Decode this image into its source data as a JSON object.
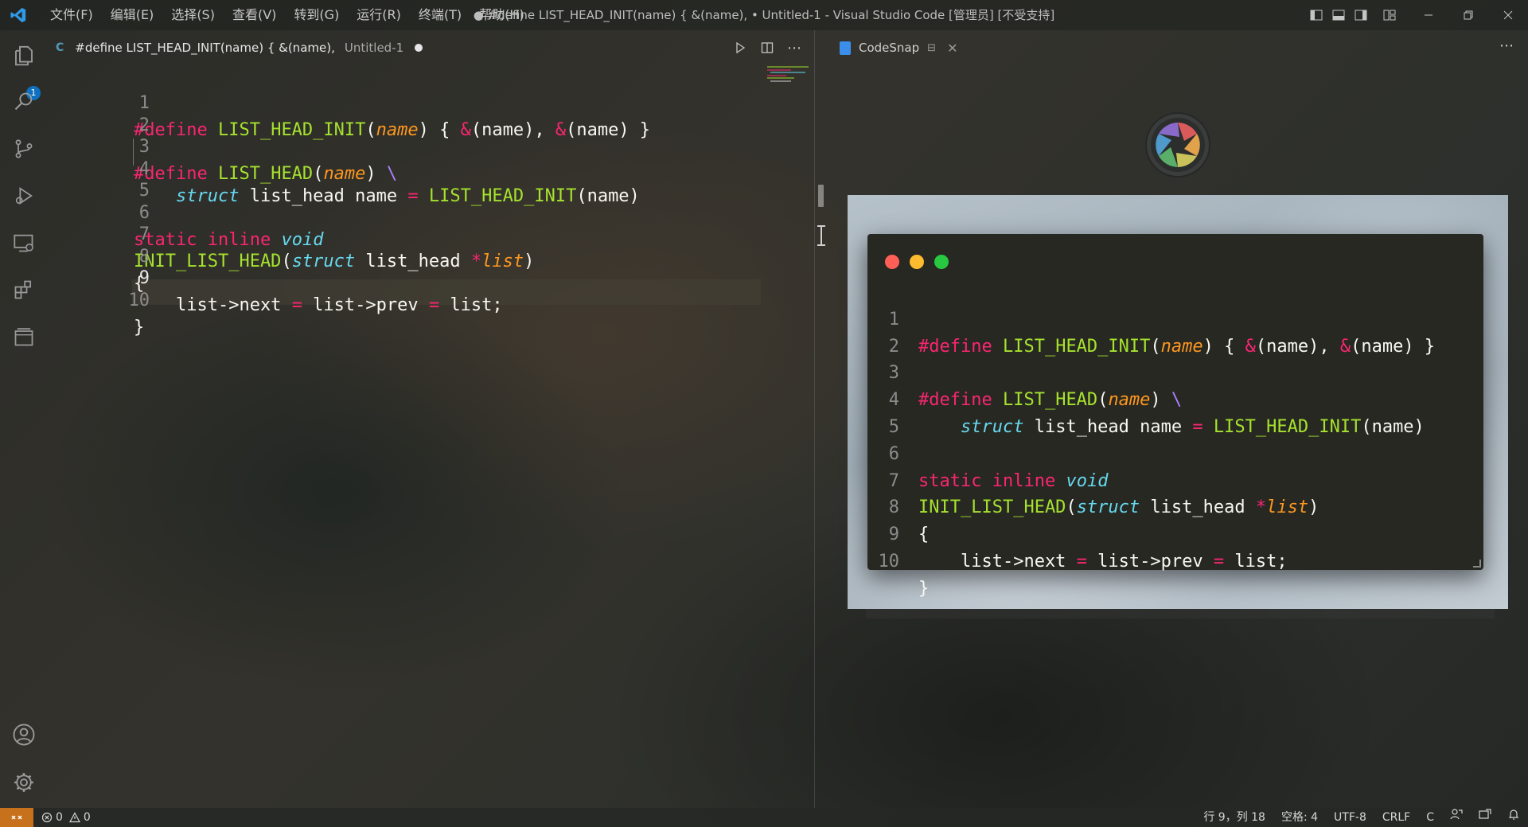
{
  "app": {
    "menu": [
      "文件(F)",
      "编辑(E)",
      "选择(S)",
      "查看(V)",
      "转到(G)",
      "运行(R)",
      "终端(T)",
      "帮助(H)"
    ],
    "window_title": "● #define LIST_HEAD_INIT(name) { &(name), • Untitled-1 - Visual Studio Code [管理员] [不受支持]"
  },
  "activity_bar": {
    "explorer_badge": "1",
    "icons": [
      "files-icon",
      "search-icon",
      "source-control-icon",
      "run-debug-icon",
      "remote-explorer-icon",
      "extensions-icon",
      "codesnap-panel-icon",
      "account-icon",
      "gear-icon"
    ]
  },
  "editor_tab": {
    "lang": "C",
    "title": "#define LIST_HEAD_INIT(name) { &(name),",
    "description": "Untitled-1"
  },
  "codesnap_tab": {
    "title": "CodeSnap"
  },
  "code": {
    "line_numbers": [
      "1",
      "2",
      "3",
      "4",
      "5",
      "6",
      "7",
      "8",
      "9",
      "10"
    ],
    "tokens": {
      "l1_define": "#define",
      "l1_fn": "LIST_HEAD_INIT",
      "l1_open": "(",
      "l1_param": "name",
      "l1_mid": ") { ",
      "l1_amp1": "&",
      "l1_n1": "(name), ",
      "l1_amp2": "&",
      "l1_end": "(name) }",
      "l3_define": "#define",
      "l3_fn": "LIST_HEAD",
      "l3_open": "(",
      "l3_param": "name",
      "l3_close": ") ",
      "l3_bs": "\\",
      "l4_indent": "    ",
      "l4_struct": "struct",
      "l4_mid": " list_head name ",
      "l4_eq": "=",
      "l4_sp": " ",
      "l4_fn": "LIST_HEAD_INIT",
      "l4_end": "(name)",
      "l6_static": "static",
      "l6_inline": "inline",
      "l6_void": "void",
      "l7_fn": "INIT_LIST_HEAD",
      "l7_open": "(",
      "l7_struct": "struct",
      "l7_mid": " list_head ",
      "l7_star": "*",
      "l7_param": "list",
      "l7_close": ")",
      "l8": "{",
      "l9_a": "    list->next ",
      "l9_eq1": "=",
      "l9_b": " list->prev ",
      "l9_eq2": "=",
      "l9_c": " list;",
      "l10": "}"
    }
  },
  "statusbar": {
    "errors": "0",
    "warnings": "0",
    "cursor": "行 9，列 18",
    "spaces": "空格: 4",
    "encoding": "UTF-8",
    "eol": "CRLF",
    "language": "C"
  },
  "colors": {
    "preprocessor": "#f92672",
    "function": "#a6e22e",
    "parameter": "#fd971f",
    "type": "#66d9ef",
    "backslash": "#ae81ff",
    "plain": "#f8f8f2",
    "remote_indicator": "#c7711d",
    "badge": "#0e70c0",
    "traffic_red": "#ff5f57",
    "traffic_yellow": "#febc2e",
    "traffic_green": "#28c840"
  }
}
